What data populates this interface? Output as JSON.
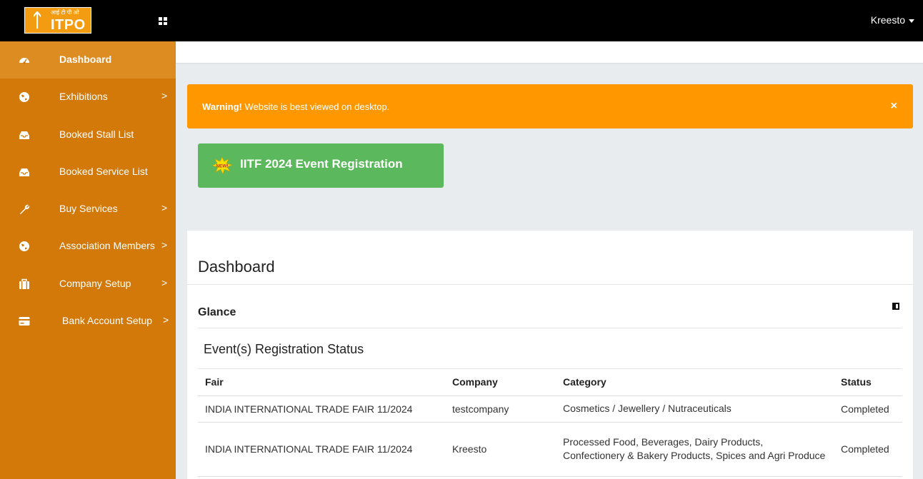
{
  "header": {
    "logo_hindi": "आई टी पी ओ",
    "logo_text": "ITPO",
    "user_name": "Kreesto"
  },
  "sidebar": {
    "items": [
      {
        "label": "Dashboard",
        "icon": "dashboard-icon",
        "active": true,
        "has_arrow": false
      },
      {
        "label": "Exhibitions",
        "icon": "globe-icon",
        "active": false,
        "has_arrow": true
      },
      {
        "label": "Booked Stall List",
        "icon": "inbox-icon",
        "active": false,
        "has_arrow": false
      },
      {
        "label": "Booked Service List",
        "icon": "inbox-icon",
        "active": false,
        "has_arrow": false
      },
      {
        "label": "Buy Services",
        "icon": "wrench-icon",
        "active": false,
        "has_arrow": true
      },
      {
        "label": "Association Members",
        "icon": "globe-icon",
        "active": false,
        "has_arrow": true
      },
      {
        "label": "Company Setup",
        "icon": "briefcase-icon",
        "active": false,
        "has_arrow": true
      },
      {
        "label": "Bank Account Setup",
        "icon": "credit-card-icon",
        "active": false,
        "has_arrow": true
      }
    ],
    "arrow": ">"
  },
  "alert": {
    "strong": "Warning!",
    "message": " Website is best viewed on desktop.",
    "close": "×"
  },
  "event_button": {
    "badge": "NEW!",
    "label": "IITF 2024 Event Registration"
  },
  "main": {
    "title": "Dashboard",
    "glance": "Glance",
    "section_title": "Event(s) Registration Status"
  },
  "table": {
    "headers": [
      "Fair",
      "Company",
      "Category",
      "Status"
    ],
    "rows": [
      [
        "INDIA INTERNATIONAL TRADE FAIR 11/2024",
        "testcompany",
        "Cosmetics / Jewellery / Nutraceuticals",
        "Completed"
      ],
      [
        "INDIA INTERNATIONAL TRADE FAIR 11/2024",
        "Kreesto",
        "Processed Food, Beverages, Dairy Products, Confectionery & Bakery Products, Spices and Agri Produce",
        "Completed"
      ]
    ]
  },
  "colors": {
    "sidebar": "#d2790a",
    "sidebar_active": "#dd8c22",
    "alert": "#ff9800",
    "success": "#5cb85c",
    "topbar": "#000000"
  }
}
